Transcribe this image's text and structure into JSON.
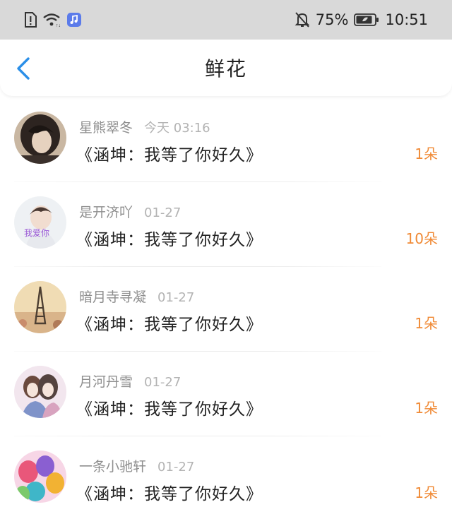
{
  "status_bar": {
    "battery": "75%",
    "time": "10:51",
    "icons": [
      "alert-sim-icon",
      "wifi-icon",
      "music-app-icon",
      "mute-bell-icon",
      "battery-icon"
    ]
  },
  "header": {
    "title": "鲜花"
  },
  "items": [
    {
      "name": "星熊翠冬",
      "time": "今天 03:16",
      "book": "《涵坤：我等了你好久》",
      "count": "1朵",
      "avatar": "avatar-dark-hair"
    },
    {
      "name": "是开济吖",
      "time": "01-27",
      "book": "《涵坤：我等了你好久》",
      "count": "10朵",
      "avatar": "avatar-boy-light"
    },
    {
      "name": "暗月寺寻凝",
      "time": "01-27",
      "book": "《涵坤：我等了你好久》",
      "count": "1朵",
      "avatar": "avatar-eiffel"
    },
    {
      "name": "月河丹雪",
      "time": "01-27",
      "book": "《涵坤：我等了你好久》",
      "count": "1朵",
      "avatar": "avatar-anime-pair"
    },
    {
      "name": "一条小驰轩",
      "time": "01-27",
      "book": "《涵坤：我等了你好久》",
      "count": "1朵",
      "avatar": "avatar-balloons"
    }
  ],
  "colors": {
    "accent_blue": "#2b8fe8",
    "count_orange": "#f08a36",
    "status_gray": "#d9d9d9"
  }
}
